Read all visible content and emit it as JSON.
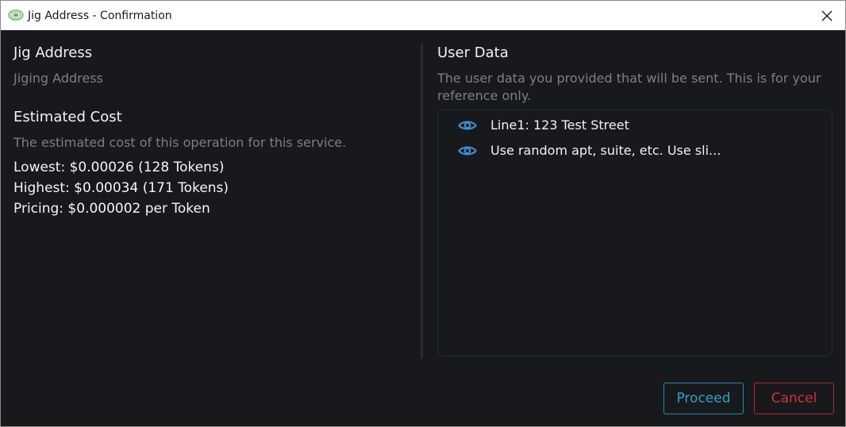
{
  "window": {
    "title": "Jig Address - Confirmation"
  },
  "left": {
    "address_title": "Jig Address",
    "address_value": "Jiging Address",
    "cost_title": "Estimated Cost",
    "cost_desc": "The estimated cost of this operation for this service.",
    "lowest": "Lowest: $0.00026 (128 Tokens)",
    "highest": "Highest: $0.00034 (171 Tokens)",
    "pricing": "Pricing: $0.000002 per Token"
  },
  "right": {
    "title": "User Data",
    "desc": "The user data you provided that will be sent. This is for your reference only.",
    "items": [
      {
        "icon": "eye-icon",
        "text": "Line1: 123 Test Street"
      },
      {
        "icon": "eye-icon",
        "text": "Use random apt, suite, etc. Use sli..."
      }
    ]
  },
  "actions": {
    "proceed_label": "Proceed",
    "cancel_label": "Cancel"
  },
  "colors": {
    "background": "#18191d",
    "accent": "#27a6c2",
    "danger": "#d2313b",
    "icon": "#3d8fd1"
  }
}
